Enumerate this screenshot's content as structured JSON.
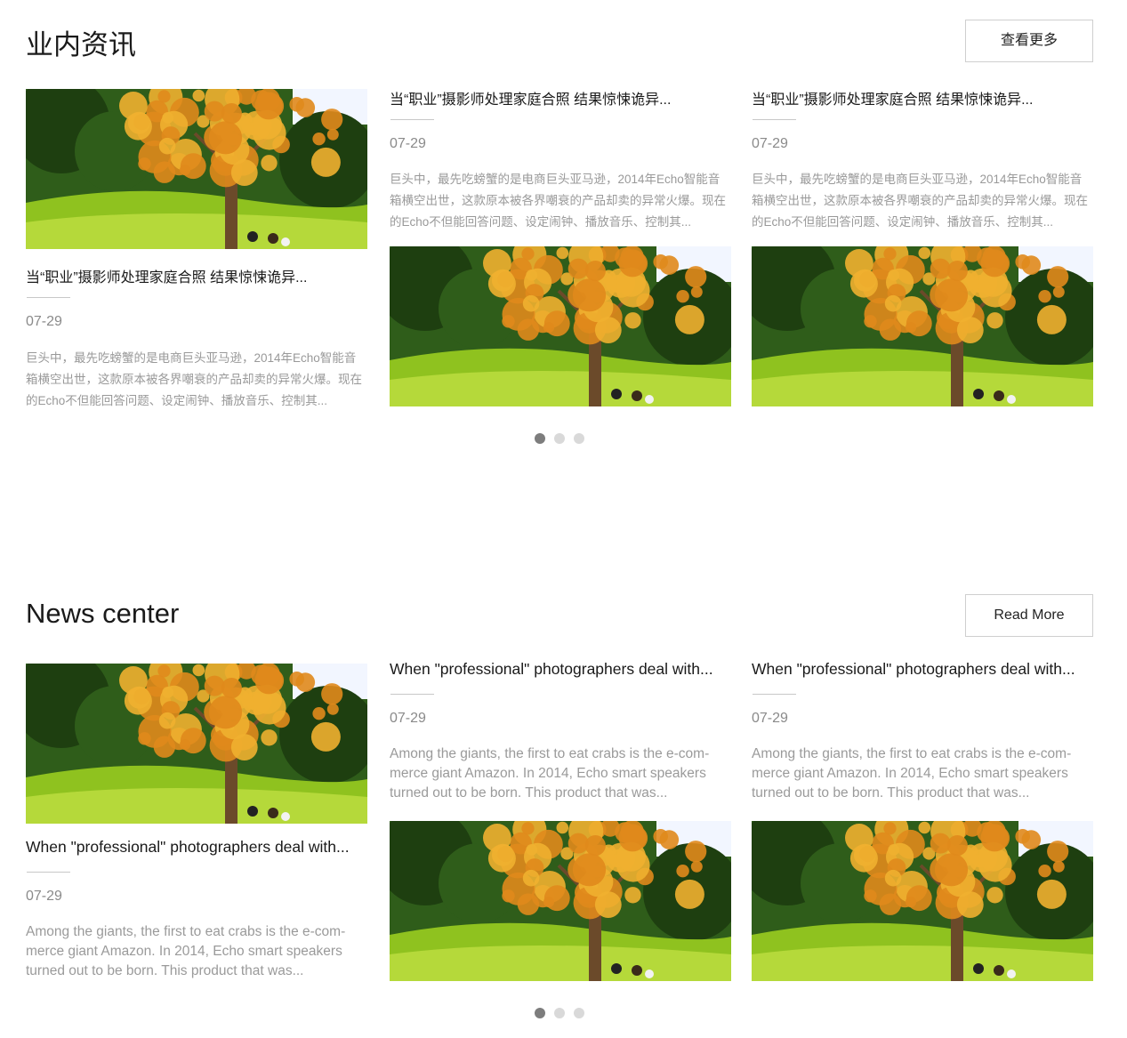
{
  "sections": [
    {
      "title": "业内资讯",
      "more_label": "查看更多",
      "cards": [
        {
          "title": "当“职业”摄影师处理家庭合照 结果惊悚诡异...",
          "date": "07-29",
          "desc": "巨头中，最先吃螃蟹的是电商巨头亚马逊，2014年Echo智能音箱横空出世，这款原本被各界嘲衰的产品却卖的异常火爆。现在的Echo不但能回答问题、设定闹钟、播放音乐、控制其..."
        },
        {
          "title": "当“职业”摄影师处理家庭合照 结果惊悚诡异...",
          "date": "07-29",
          "desc": "巨头中，最先吃螃蟹的是电商巨头亚马逊，2014年Echo智能音箱横空出世，这款原本被各界嘲衰的产品却卖的异常火爆。现在的Echo不但能回答问题、设定闹钟、播放音乐、控制其..."
        },
        {
          "title": "当“职业”摄影师处理家庭合照 结果惊悚诡异...",
          "date": "07-29",
          "desc": "巨头中，最先吃螃蟹的是电商巨头亚马逊，2014年Echo智能音箱横空出世，这款原本被各界嘲衰的产品却卖的异常火爆。现在的Echo不但能回答问题、设定闹钟、播放音乐、控制其..."
        }
      ],
      "pagination": {
        "count": 3,
        "active": 1
      }
    },
    {
      "title": "News center",
      "more_label": "Read More",
      "cards": [
        {
          "title": "When \"professional\" photographers deal with...",
          "date": "07-29",
          "desc": "Among the giants, the first to eat crabs is the e-com- merce giant Amazon. In 2014, Echo smart speakers turned out to be born. This product that was..."
        },
        {
          "title": "When \"professional\" photographers deal with...",
          "date": "07-29",
          "desc": "Among the giants, the first to eat crabs is the e-com- merce giant Amazon. In 2014, Echo smart speakers turned out to be born. This product that was..."
        },
        {
          "title": "When \"professional\" photographers deal with...",
          "date": "07-29",
          "desc": "Among the giants, the first to eat crabs is the e-com- merce giant Amazon. In 2014, Echo smart speakers turned out to be born. This product that was..."
        }
      ],
      "pagination": {
        "count": 3,
        "active": 1
      }
    }
  ],
  "photo_palette": {
    "sky": "#f2f6ff",
    "forest": "#2f5d1a",
    "forest_dark": "#1e3f10",
    "grass": "#8fc21f",
    "grass_light": "#b5d93a",
    "foliage": "#e08a1c",
    "foliage_light": "#f0b030",
    "trunk": "#6b4a2a"
  }
}
